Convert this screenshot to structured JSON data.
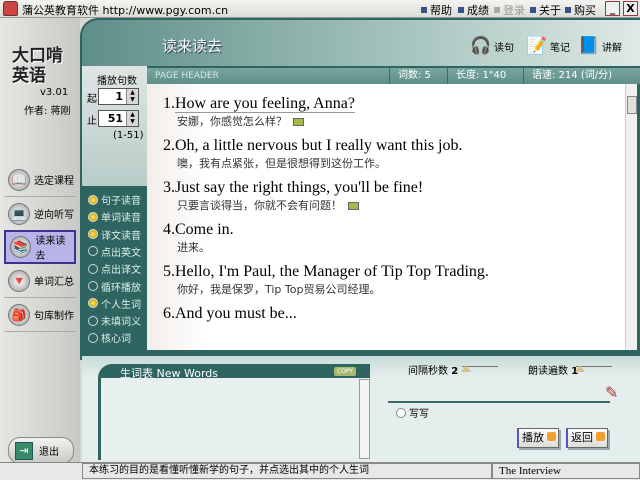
{
  "titlebar": {
    "title": "蒲公英教育软件 http://www.pgy.com.cn",
    "menus": [
      {
        "label": "帮助",
        "enabled": true
      },
      {
        "label": "成绩",
        "enabled": true
      },
      {
        "label": "登录",
        "enabled": false
      },
      {
        "label": "关于",
        "enabled": true
      },
      {
        "label": "购买",
        "enabled": true
      }
    ],
    "minimize": "_",
    "close": "X"
  },
  "brand": {
    "logo": "大口啃英语",
    "version": "v3.01",
    "author": "作者: 蒋刚"
  },
  "nav": [
    {
      "label": "选定课程",
      "icon": "book-icon"
    },
    {
      "label": "逆向听写",
      "icon": "laptop-icon"
    },
    {
      "label": "读来读去",
      "icon": "reader-icon",
      "active": true
    },
    {
      "label": "单词汇总",
      "icon": "funnel-icon"
    },
    {
      "label": "句库制作",
      "icon": "bag-icon"
    }
  ],
  "exit": "退出",
  "header": {
    "title": "读来读去",
    "tools": [
      {
        "label": "读句",
        "icon": "headphones-icon"
      },
      {
        "label": "笔记",
        "icon": "notepad-icon"
      },
      {
        "label": "讲解",
        "icon": "explain-book-icon"
      }
    ]
  },
  "sentence_count": {
    "label": "播放句数",
    "start_label": "起",
    "start": "1",
    "end_label": "止",
    "end": "51",
    "range": "(1-51)"
  },
  "options": [
    {
      "label": "句子读音",
      "on": true
    },
    {
      "label": "单词读音",
      "on": true
    },
    {
      "label": "译文读音",
      "on": true
    },
    {
      "label": "点出英文",
      "on": false
    },
    {
      "label": "点出译文",
      "on": false
    },
    {
      "label": "循环播放",
      "on": false
    },
    {
      "label": "个人生词",
      "on": true
    },
    {
      "label": "未填词义",
      "on": false
    },
    {
      "label": "核心词",
      "on": false
    }
  ],
  "content_header": {
    "page_header": "PAGE HEADER",
    "words": "词数: 5",
    "length": "长度: 1\"40",
    "speed": "语速: 214 (词/分)"
  },
  "sentences": [
    {
      "num": "1.",
      "en": "How are you feeling, Anna?",
      "zh": "安娜，你感觉怎么样？",
      "note": true
    },
    {
      "num": "2.",
      "en": "Oh, a little nervous but I really want this job.",
      "zh": "噢，我有点紧张，但是很想得到这份工作。",
      "note": false
    },
    {
      "num": "3.",
      "en": "Just say the right things, you'll be fine!",
      "zh": "只要言谈得当，你就不会有问题！",
      "note": true
    },
    {
      "num": "4.",
      "en": "Come in.",
      "zh": "进来。",
      "note": false
    },
    {
      "num": "5.",
      "en": "Hello, I'm Paul, the Manager of Tip Top Trading.",
      "zh": "你好，我是保罗，Tip Top贸易公司经理。",
      "note": false
    },
    {
      "num": "6.",
      "en": "And you must be...",
      "zh": "",
      "note": false
    }
  ],
  "new_words": {
    "title": "生词表 New Words",
    "copy": "COPY"
  },
  "controls": {
    "interval_label": "间隔秒数",
    "interval": "2",
    "repeat_label": "朗读遍数",
    "repeat": "1",
    "write_label": "写写",
    "play": "播放",
    "back": "返回"
  },
  "status": {
    "message": "本练习的目的是看懂听懂新学的句子，并点选出其中的个人生词",
    "lesson": "The Interview"
  }
}
